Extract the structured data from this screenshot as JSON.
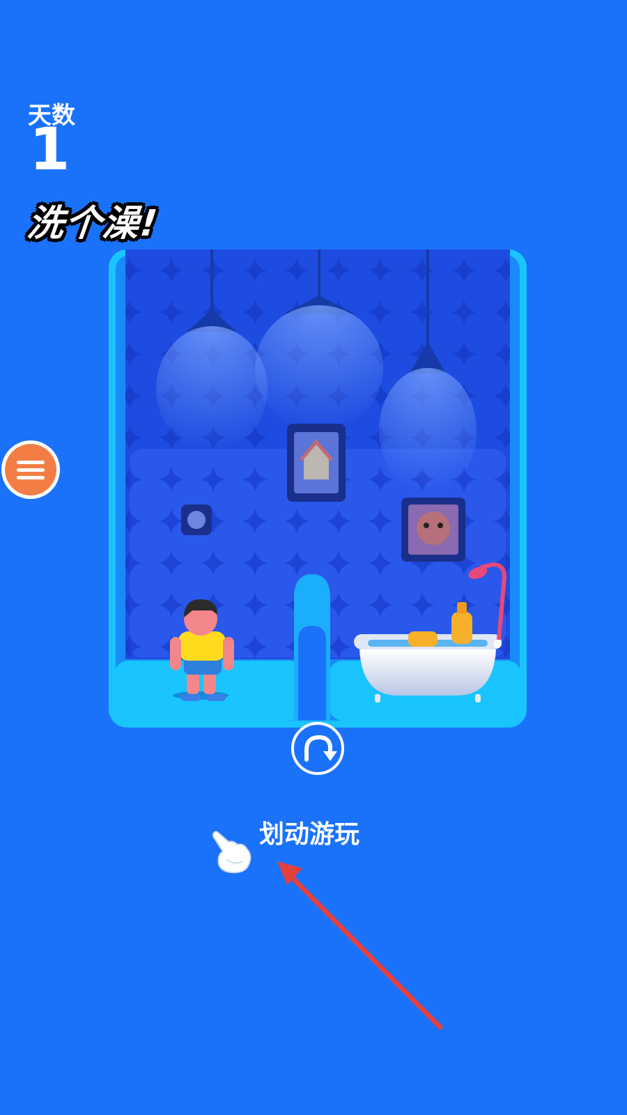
{
  "hud": {
    "day_label": "天数",
    "day_number": "1",
    "task_title": "洗个澡!"
  },
  "menu_button": {
    "icon": "hamburger-menu-icon",
    "color": "#f37e45"
  },
  "room": {
    "scene": "bathroom",
    "characters": [
      "boy"
    ],
    "objects": [
      "ceiling-lamp",
      "ceiling-lamp",
      "ceiling-lamp",
      "house-picture-frame",
      "cat-picture-frame",
      "small-wall-badge",
      "bathtub",
      "soap",
      "shampoo-bottle",
      "shower-head",
      "divider-pipe"
    ]
  },
  "rotate_button": {
    "icon": "rotate-clockwise-icon"
  },
  "hint": {
    "text": "划动游玩",
    "icon": "pointing-hand-icon"
  },
  "colors": {
    "background": "#1a72fb",
    "room_wall": "#1e4ce0",
    "room_border": "#19c4ff",
    "arrow": "#e5403c"
  }
}
